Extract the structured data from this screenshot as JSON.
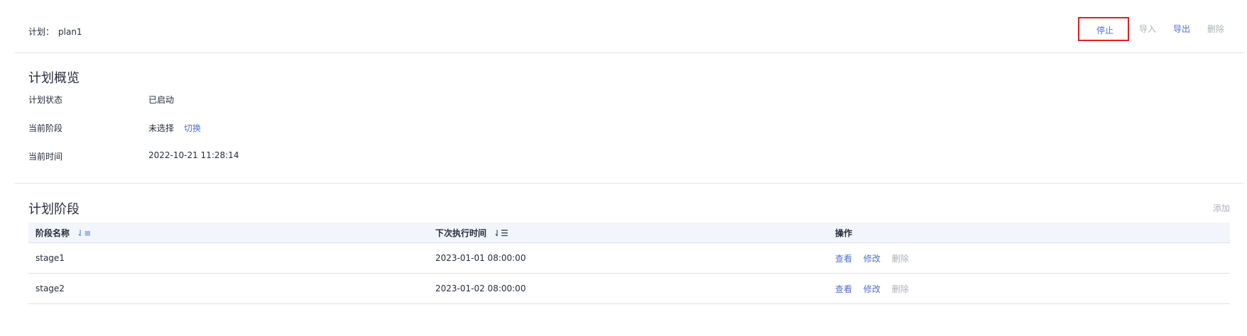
{
  "header": {
    "plan_label": "计划：",
    "plan_name": "plan1",
    "actions": [
      {
        "label": "停止",
        "enabled": true,
        "highlighted": true
      },
      {
        "label": "导入",
        "enabled": false
      },
      {
        "label": "导出",
        "enabled": true
      },
      {
        "label": "删除",
        "enabled": false
      }
    ]
  },
  "overview": {
    "title": "计划概览",
    "status_label": "计划状态",
    "status_value": "已启动",
    "stage_label": "当前阶段",
    "stage_value": "未选择",
    "stage_switch_link": "切换",
    "time_label": "当前时间",
    "time_value": "2022-10-21 11:28:14"
  },
  "stages": {
    "title": "计划阶段",
    "add_label": "添加",
    "columns": [
      "阶段名称",
      "下次执行时间",
      "操作"
    ],
    "sort_icons": [
      "sort-asc-icon",
      "sort-desc-icon"
    ],
    "rows": [
      {
        "name": "stage1",
        "next_time": "2023-01-01 08:00:00",
        "ops": [
          "查看",
          "修改",
          "删除"
        ]
      },
      {
        "name": "stage2",
        "next_time": "2023-01-02 08:00:00",
        "ops": [
          "查看",
          "修改",
          "删除"
        ]
      }
    ]
  },
  "colors": {
    "accent": "#526ecc",
    "disabled": "#adb0b8",
    "highlight_border": "#e02020",
    "table_header_bg": "#f2f5fc"
  }
}
